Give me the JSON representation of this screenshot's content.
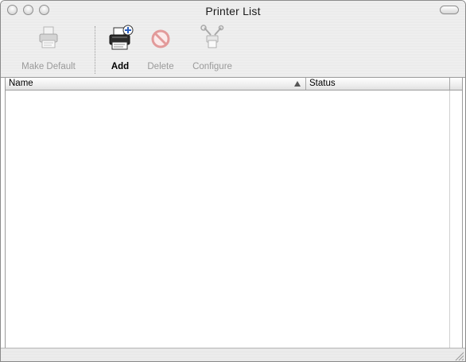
{
  "window": {
    "title": "Printer List"
  },
  "toolbar": {
    "buttons": [
      {
        "label": "Make Default",
        "icon": "printer-icon",
        "enabled": false
      },
      {
        "label": "Add",
        "icon": "add-printer-icon",
        "enabled": true
      },
      {
        "label": "Delete",
        "icon": "delete-icon",
        "enabled": false
      },
      {
        "label": "Configure",
        "icon": "configure-tools-icon",
        "enabled": false
      }
    ]
  },
  "table": {
    "columns": [
      {
        "label": "Name",
        "sort": "ascending"
      },
      {
        "label": "Status"
      }
    ],
    "rows": []
  },
  "colors": {
    "delete_red": "#e8a0a0",
    "disabled_text": "#9a9a9a"
  }
}
